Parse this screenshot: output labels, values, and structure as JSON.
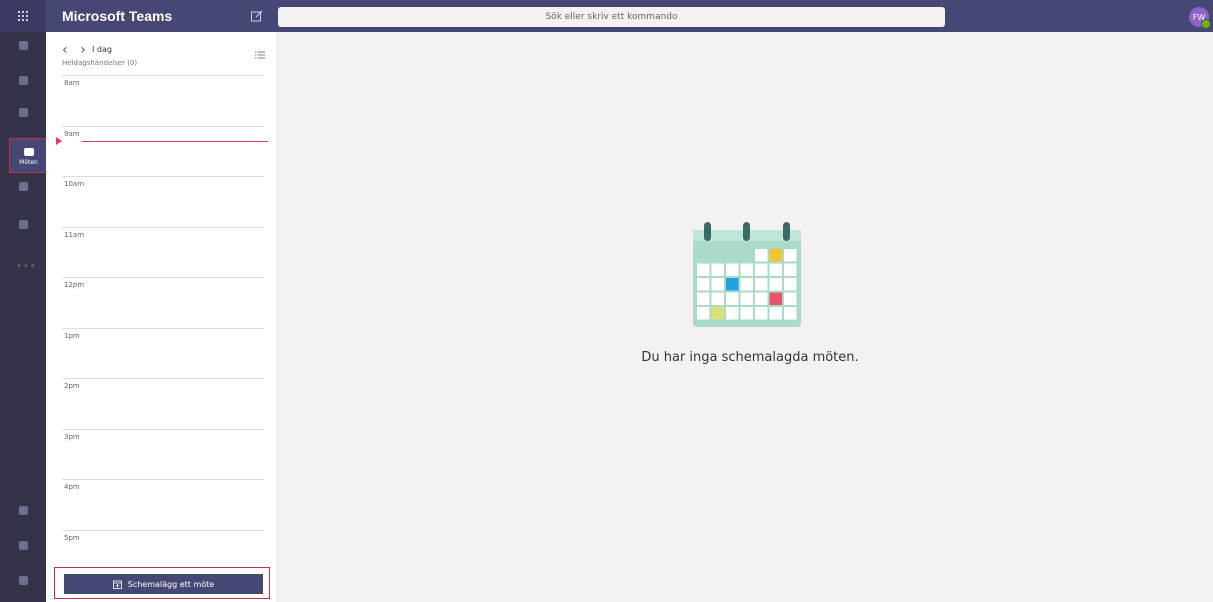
{
  "topbar": {
    "app_title": "Microsoft Teams",
    "search_placeholder": "Sök eller skriv ett kommando",
    "avatar_initials": "FW",
    "waffle_icon": "waffle-grid-icon",
    "compose_icon": "compose-new-chat-icon"
  },
  "rail": {
    "items": [
      {
        "icon": "activity-icon",
        "label": ""
      },
      {
        "icon": "chat-icon",
        "label": ""
      },
      {
        "icon": "teams-icon",
        "label": ""
      },
      {
        "icon": "calendar-icon",
        "label": "Möten",
        "active": true
      },
      {
        "icon": "calls-icon",
        "label": ""
      },
      {
        "icon": "files-icon",
        "label": ""
      }
    ],
    "bottom_items": [
      {
        "icon": "apps-icon",
        "label": ""
      },
      {
        "icon": "help-icon",
        "label": ""
      },
      {
        "icon": "feedback-icon",
        "label": ""
      }
    ]
  },
  "calendar": {
    "today_label": "I dag",
    "allday_label": "Heldagshändelser (0)",
    "time_slots": [
      "8am",
      "9am",
      "10am",
      "11am",
      "12pm",
      "1pm",
      "2pm",
      "3pm",
      "4pm",
      "5pm"
    ],
    "schedule_button": "Schemalägg ett möte"
  },
  "main": {
    "empty_message": "Du har inga schemalagda möten."
  },
  "colors": {
    "topbar": "#464775",
    "rail": "#33344a",
    "accent_red": "#c4314b",
    "now_line": "#e5394f",
    "calendar_green": "#a9dbc7"
  }
}
